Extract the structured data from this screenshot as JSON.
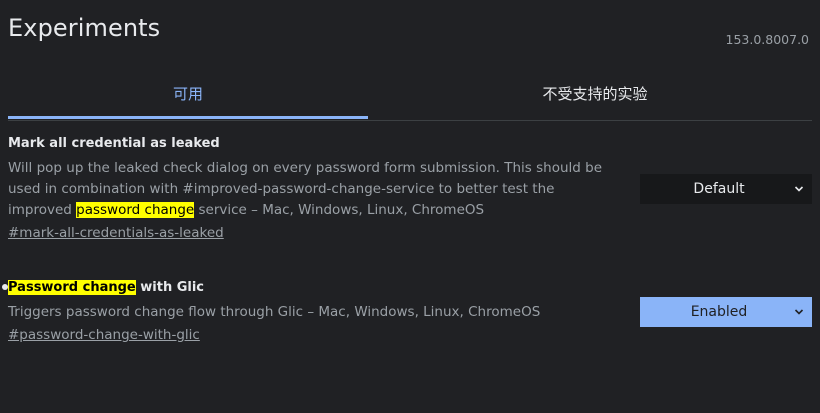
{
  "header": {
    "title": "Experiments",
    "version": "153.0.8007.0"
  },
  "tabs": [
    {
      "label": "可用",
      "active": true
    },
    {
      "label": "不受支持的实验",
      "active": false
    }
  ],
  "experiments": [
    {
      "name": "Mark all credential as leaked",
      "desc_before": "Will pop up the leaked check dialog on every password form submission. This should be used in combination with #improved-password-change-service to better test the improved ",
      "desc_highlight": "password change",
      "desc_after": " service – Mac, Windows, Linux, ChromeOS",
      "link": "#mark-all-credentials-as-leaked",
      "select_value": "Default"
    },
    {
      "name_highlight": "Password change",
      "name_after": " with Glic",
      "desc": "Triggers password change flow through Glic – Mac, Windows, Linux, ChromeOS",
      "link": "#password-change-with-glic",
      "select_value": "Enabled"
    }
  ],
  "colors": {
    "background": "#202124",
    "accent": "#8ab4f8",
    "highlight": "#ffff00",
    "muted_text": "#9aa0a6"
  }
}
